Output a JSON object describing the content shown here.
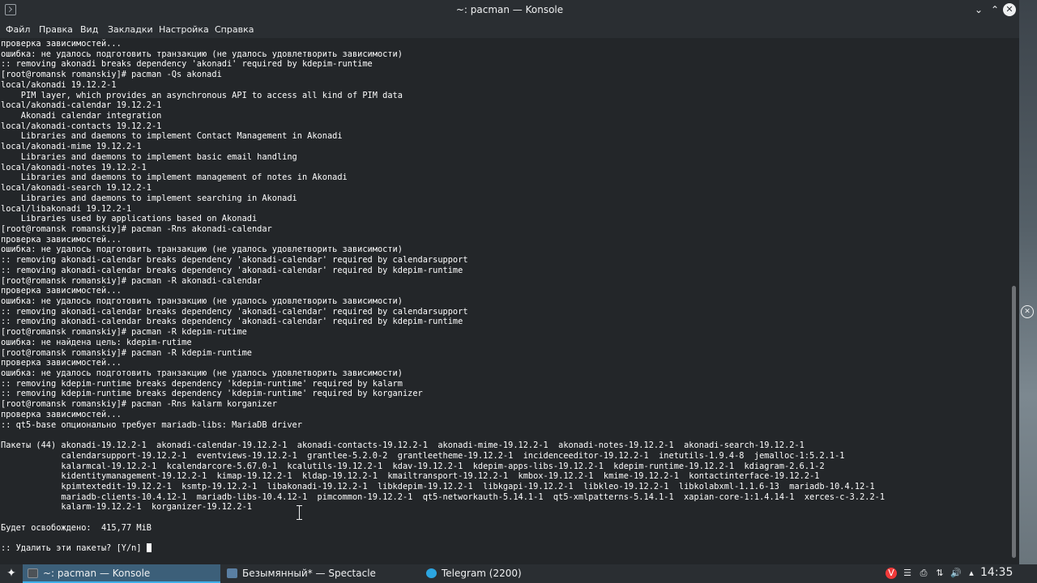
{
  "window": {
    "title": "~: pacman — Konsole",
    "icon": "terminal-icon"
  },
  "menubar": {
    "items": [
      "Файл",
      "Правка",
      "Вид",
      "Закладки",
      "Настройка",
      "Справка"
    ]
  },
  "terminal": {
    "lines": [
      "проверка зависимостей...",
      "ошибка: не удалось подготовить транзакцию (не удалось удовлетворить зависимости)",
      ":: removing akonadi breaks dependency 'akonadi' required by kdepim-runtime",
      "[root@romansk romanskiy]# pacman -Qs akonadi",
      "local/akonadi 19.12.2-1",
      "    PIM layer, which provides an asynchronous API to access all kind of PIM data",
      "local/akonadi-calendar 19.12.2-1",
      "    Akonadi calendar integration",
      "local/akonadi-contacts 19.12.2-1",
      "    Libraries and daemons to implement Contact Management in Akonadi",
      "local/akonadi-mime 19.12.2-1",
      "    Libraries and daemons to implement basic email handling",
      "local/akonadi-notes 19.12.2-1",
      "    Libraries and daemons to implement management of notes in Akonadi",
      "local/akonadi-search 19.12.2-1",
      "    Libraries and daemons to implement searching in Akonadi",
      "local/libakonadi 19.12.2-1",
      "    Libraries used by applications based on Akonadi",
      "[root@romansk romanskiy]# pacman -Rns akonadi-calendar",
      "проверка зависимостей...",
      "ошибка: не удалось подготовить транзакцию (не удалось удовлетворить зависимости)",
      ":: removing akonadi-calendar breaks dependency 'akonadi-calendar' required by calendarsupport",
      ":: removing akonadi-calendar breaks dependency 'akonadi-calendar' required by kdepim-runtime",
      "[root@romansk romanskiy]# pacman -R akonadi-calendar",
      "проверка зависимостей...",
      "ошибка: не удалось подготовить транзакцию (не удалось удовлетворить зависимости)",
      ":: removing akonadi-calendar breaks dependency 'akonadi-calendar' required by calendarsupport",
      ":: removing akonadi-calendar breaks dependency 'akonadi-calendar' required by kdepim-runtime",
      "[root@romansk romanskiy]# pacman -R kdepim-rutime",
      "ошибка: не найдена цель: kdepim-rutime",
      "[root@romansk romanskiy]# pacman -R kdepim-runtime",
      "проверка зависимостей...",
      "ошибка: не удалось подготовить транзакцию (не удалось удовлетворить зависимости)",
      ":: removing kdepim-runtime breaks dependency 'kdepim-runtime' required by kalarm",
      ":: removing kdepim-runtime breaks dependency 'kdepim-runtime' required by korganizer",
      "[root@romansk romanskiy]# pacman -Rns kalarm korganizer",
      "проверка зависимостей...",
      ":: qt5-base опционально требует mariadb-libs: MariaDB driver",
      "",
      "Пакеты (44) akonadi-19.12.2-1  akonadi-calendar-19.12.2-1  akonadi-contacts-19.12.2-1  akonadi-mime-19.12.2-1  akonadi-notes-19.12.2-1  akonadi-search-19.12.2-1",
      "            calendarsupport-19.12.2-1  eventviews-19.12.2-1  grantlee-5.2.0-2  grantleetheme-19.12.2-1  incidenceeditor-19.12.2-1  inetutils-1.9.4-8  jemalloc-1:5.2.1-1",
      "            kalarmcal-19.12.2-1  kcalendarcore-5.67.0-1  kcalutils-19.12.2-1  kdav-19.12.2-1  kdepim-apps-libs-19.12.2-1  kdepim-runtime-19.12.2-1  kdiagram-2.6.1-2",
      "            kidentitymanagement-19.12.2-1  kimap-19.12.2-1  kldap-19.12.2-1  kmailtransport-19.12.2-1  kmbox-19.12.2-1  kmime-19.12.2-1  kontactinterface-19.12.2-1",
      "            kpimtextedit-19.12.2-1  ksmtp-19.12.2-1  libakonadi-19.12.2-1  libkdepim-19.12.2-1  libkgapi-19.12.2-1  libkleo-19.12.2-1  libkolabxml-1.1.6-13  mariadb-10.4.12-1",
      "            mariadb-clients-10.4.12-1  mariadb-libs-10.4.12-1  pimcommon-19.12.2-1  qt5-networkauth-5.14.1-1  qt5-xmlpatterns-5.14.1-1  xapian-core-1:1.4.14-1  xerces-c-3.2.2-1",
      "            kalarm-19.12.2-1  korganizer-19.12.2-1",
      "",
      "Будет освобождено:  415,77 MiB",
      "",
      ":: Удалить эти пакеты? [Y/n] "
    ]
  },
  "taskbar": {
    "launcher_icon": "application-launcher-icon",
    "tasks": [
      {
        "label": "~: pacman — Konsole",
        "icon": "konsole-icon",
        "color": "#4d5257",
        "active": true
      },
      {
        "label": "Безымянный* — Spectacle",
        "icon": "spectacle-icon",
        "color": "#5a7fa3",
        "active": false
      },
      {
        "label": "Telegram (2200)",
        "icon": "telegram-icon",
        "color": "#2ca5e0",
        "active": false
      }
    ],
    "tray": [
      "vivaldi-icon",
      "clipboard-icon",
      "printer-icon",
      "network-icon",
      "volume-icon",
      "chevron-up-icon"
    ],
    "clock": "14:35"
  },
  "colors": {
    "terminal_bg": "#232629",
    "text": "#fcfcfc",
    "chrome": "#2a2e32",
    "accent": "#3daee9"
  }
}
